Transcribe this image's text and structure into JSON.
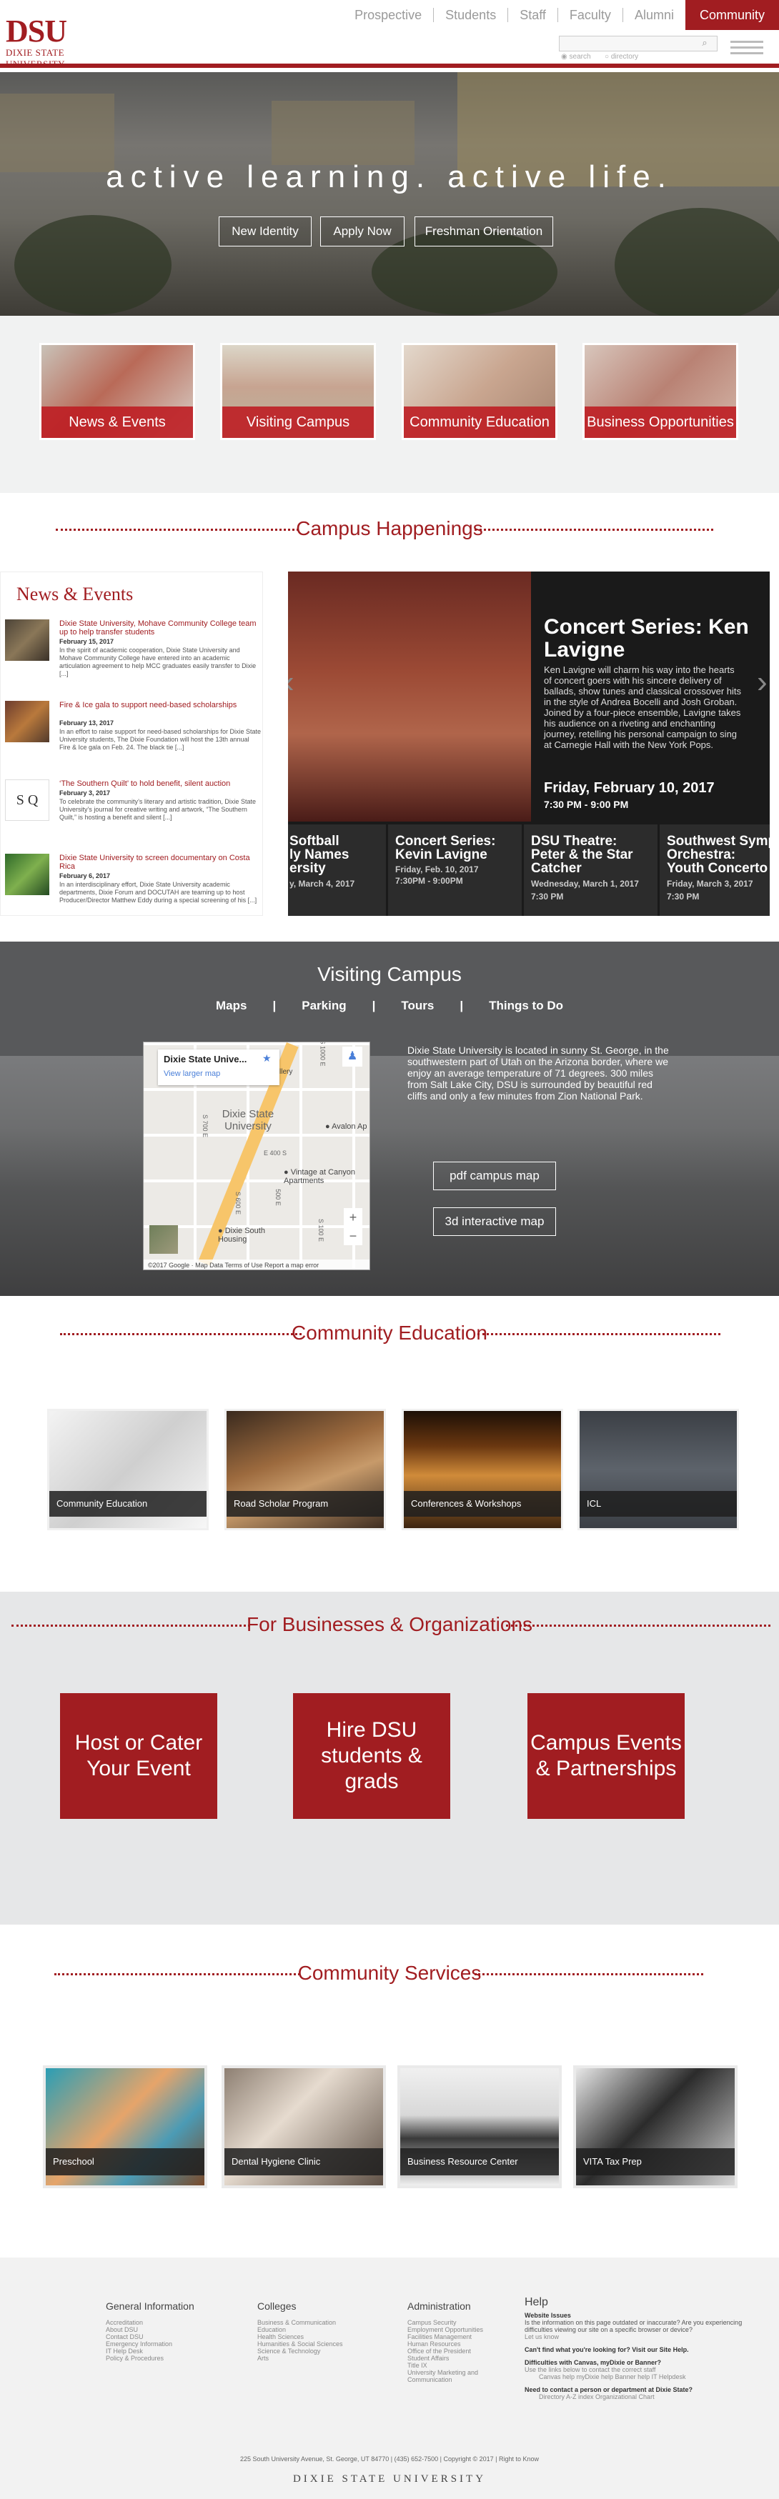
{
  "header": {
    "logo_big": "DSU",
    "logo_small": "DIXIE STATE UNIVERSITY",
    "nav": [
      "Prospective",
      "Students",
      "Staff",
      "Faculty",
      "Alumni",
      "Community"
    ],
    "search_label": "search",
    "directory_label": "directory",
    "accent_color": "#a11d21"
  },
  "hero": {
    "title": "active learning. active life.",
    "buttons": [
      "New Identity",
      "Apply Now",
      "Freshman Orientation"
    ]
  },
  "quick_links": [
    "News & Events",
    "Visiting Campus",
    "Community Education",
    "Business Opportunities"
  ],
  "happenings": {
    "title": "Campus Happenings",
    "news_heading": "News & Events",
    "news": [
      {
        "title": "Dixie State University, Mohave Community College team up to help transfer students",
        "date": "February 15, 2017",
        "body": "In the spirit of academic cooperation, Dixie State University and Mohave Community College have entered into an academic articulation agreement to help MCC graduates easily transfer to Dixie [...]"
      },
      {
        "title": "Fire & Ice gala to support need-based scholarships",
        "date": "February 13, 2017",
        "body": "In an effort to raise support for need-based scholarships for Dixie State University students, The Dixie Foundation will host the 13th annual Fire & Ice gala on Feb. 24. The black tie [...]"
      },
      {
        "title": "‘The Southern Quilt’ to hold benefit, silent auction",
        "date": "February 3, 2017",
        "body": "To celebrate the community’s literary and artistic tradition, Dixie State University’s journal for creative writing and artwork, “The Southern Quilt,” is hosting a benefit and silent [...]"
      },
      {
        "title": "Dixie State University to screen documentary on Costa Rica",
        "date": "February 6, 2017",
        "body": "In an interdisciplinary effort, Dixie State University academic departments, Dixie Forum and DOCUTAH are teaming up to host Producer/Director Matthew Eddy during a special screening of his [...]"
      }
    ],
    "featured": {
      "title": "Concert Series: Ken Lavigne",
      "body": "Ken Lavigne will charm his way into the hearts of concert goers with his sincere delivery of ballads, show tunes and classical crossover hits in the style of Andrea Bocelli and Josh Groban. Joined by a four-piece ensemble, Lavigne takes his audience on a riveting and enchanting journey, retelling his personal campaign to sing at Carnegie Hall with the New York Pops.",
      "date": "Friday, February 10, 2017",
      "time": "7:30 PM - 9:00 PM"
    },
    "events": [
      {
        "title": "Softball\nly Names\nersity",
        "date": "",
        "meta": "y, March 4, 2017"
      },
      {
        "title": "Concert Series:\nKevin Lavigne",
        "date": "Friday, Feb. 10, 2017",
        "meta": "7:30PM - 9:00PM"
      },
      {
        "title": "DSU Theatre:\nPeter & the Star\nCatcher",
        "date": "Wednesday, March 1, 2017",
        "meta": "7:30 PM"
      },
      {
        "title": "Southwest Symp\nOrchestra:\nYouth Concerto C",
        "date": "Friday, March 3, 2017",
        "meta": "7:30 PM"
      }
    ]
  },
  "visiting": {
    "title": "Visiting Campus",
    "links": [
      "Maps",
      "|",
      "Parking",
      "|",
      "Tours",
      "|",
      "Things to Do"
    ],
    "map_title": "Dixie State Unive...",
    "map_link": "View larger map",
    "map_labels": [
      "Dixie State University",
      "Avalon Ap",
      "Vintage at Canyon Apartments",
      "Dixie South Housing",
      "llery",
      "S 1000 E",
      "S 700 E",
      "E 400 S",
      "S 600 E",
      "500 E",
      "S 100 E"
    ],
    "map_footer": "©2017 Google · Map Data   Terms of Use   Report a map error",
    "text": "Dixie State University is located in sunny St. George, in the southwestern part of Utah on the Arizona border, where we enjoy an average temperature of 71 degrees. 300 miles from Salt Lake City, DSU is surrounded by beautiful red cliffs and only a few minutes from Zion National Park.",
    "buttons": [
      "pdf campus map",
      "3d interactive map"
    ]
  },
  "community_ed": {
    "title": "Community Education",
    "cards": [
      "Community Education",
      "Road Scholar Program",
      "Conferences & Workshops",
      "ICL"
    ]
  },
  "business": {
    "title": "For Businesses & Organizations",
    "boxes": [
      "Host or Cater\nYour Event",
      "Hire DSU\nstudents & grads",
      "Campus Events\n& Partnerships"
    ]
  },
  "services": {
    "title": "Community Services",
    "cards": [
      "Preschool",
      "Dental Hygiene Clinic",
      "Business Resource Center",
      "VITA Tax Prep"
    ]
  },
  "footer": {
    "cols": [
      {
        "head": "General Information",
        "links": [
          "Accreditation",
          "About DSU",
          "Contact DSU",
          "Emergency Information",
          "IT Help Desk",
          "Policy & Procedures"
        ]
      },
      {
        "head": "Colleges",
        "links": [
          "Business & Communication",
          "Education",
          "Health Sciences",
          "Humanities & Social Sciences",
          "Science & Technology",
          "Arts"
        ]
      },
      {
        "head": "Administration",
        "links": [
          "Campus Security",
          "Employment Opportunities",
          "Facilities Management",
          "Human Resources",
          "Office of the President",
          "Student Affairs",
          "Title IX",
          "University Marketing and Communication"
        ]
      }
    ],
    "help_head": "Help",
    "help_lines": [
      "Website Issues",
      "Is the information on this page outdated or inaccurate? Are you experiencing difficulties viewing our site on a specific browser or device?",
      "Let us know",
      "Can't find what you're looking for? Visit our Site Help.",
      "Difficulties with Canvas, myDixie or Banner?",
      "Use the links below to contact the correct staff",
      "Canvas help     myDixie help     Banner help     IT Helpdesk",
      "Need to contact a person or department at Dixie State?",
      "Directory     A-Z index     Organizational Chart"
    ],
    "address": "225 South University Avenue, St. George, UT 84770   |   (435) 652-7500   |   Copyright © 2017   |   Right to Know",
    "name": "DIXIE STATE UNIVERSITY"
  }
}
